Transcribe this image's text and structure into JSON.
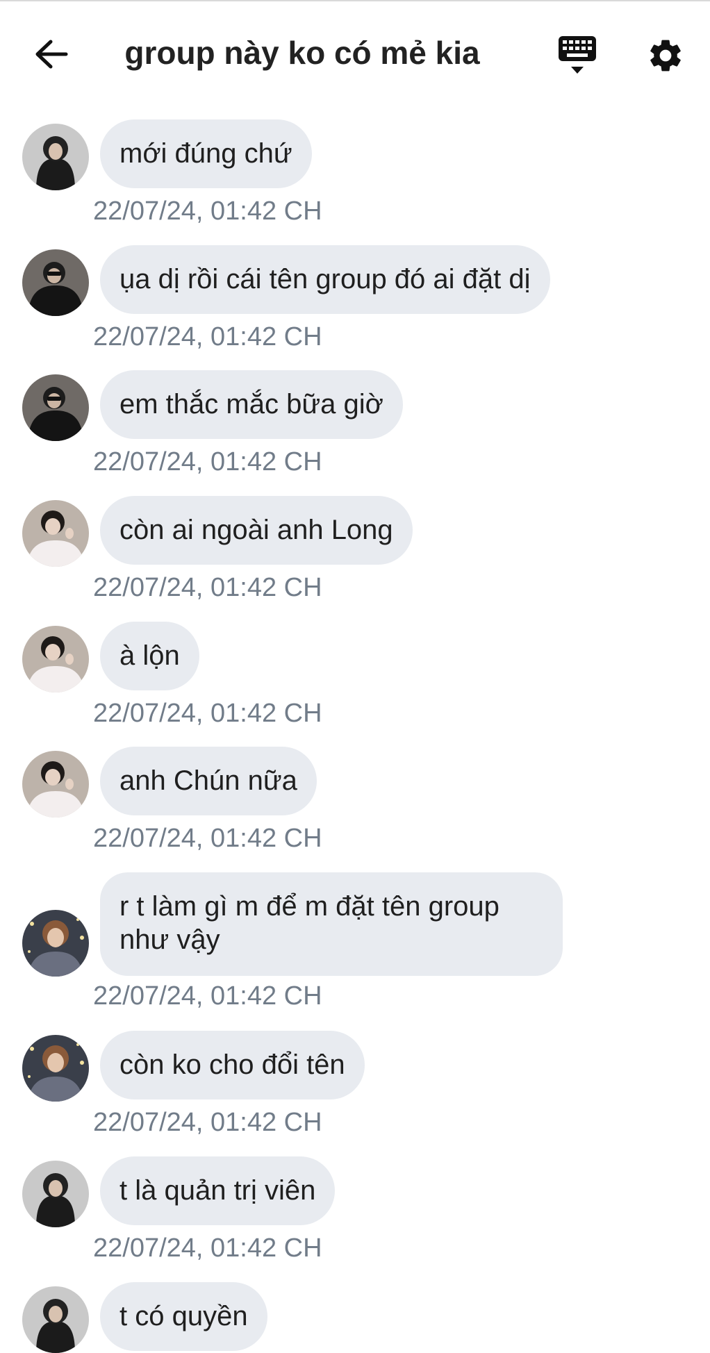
{
  "header": {
    "title": "group này ko có mẻ kia"
  },
  "icons": {
    "back": "arrow-left-icon",
    "keyboard": "keyboard-icon",
    "settings": "gear-icon"
  },
  "colors": {
    "bubble": "#e8ebf0",
    "timestamp": "#717c89",
    "text": "#1f1f1f"
  },
  "messages": [
    {
      "text": "mới đúng chứ",
      "time": "22/07/24, 01:42 CH",
      "avatar": "user-black-hoodie"
    },
    {
      "text": "ụa dị rồi cái tên group đó ai đặt dị",
      "time": "22/07/24, 01:42 CH",
      "avatar": "user-sunglasses"
    },
    {
      "text": "em thắc mắc bữa giờ",
      "time": "22/07/24, 01:42 CH",
      "avatar": "user-sunglasses"
    },
    {
      "text": "còn ai ngoài anh Long",
      "time": "22/07/24, 01:42 CH",
      "avatar": "user-white-shirt"
    },
    {
      "text": "à lộn",
      "time": "22/07/24, 01:42 CH",
      "avatar": "user-white-shirt"
    },
    {
      "text": "anh Chún nữa",
      "time": "22/07/24, 01:42 CH",
      "avatar": "user-white-shirt"
    },
    {
      "text": "r t làm gì m để m đặt tên group như vậy",
      "time": "22/07/24, 01:42 CH",
      "avatar": "user-glitter"
    },
    {
      "text": "còn ko cho đổi tên",
      "time": "22/07/24, 01:42 CH",
      "avatar": "user-glitter"
    },
    {
      "text": "t là quản trị viên",
      "time": "22/07/24, 01:42 CH",
      "avatar": "user-black-hoodie"
    },
    {
      "text": "t có quyền",
      "time": "",
      "avatar": "user-black-hoodie"
    }
  ]
}
